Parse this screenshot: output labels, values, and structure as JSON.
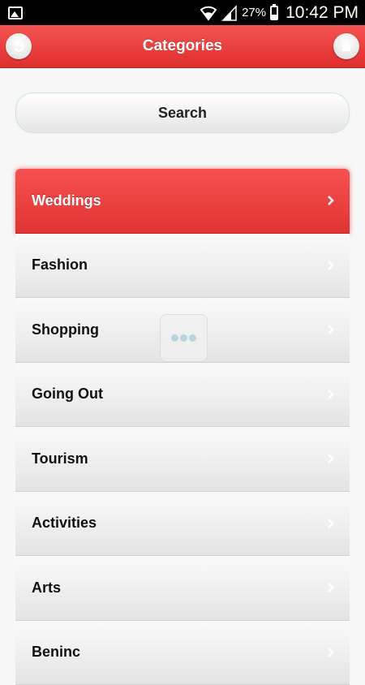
{
  "status_bar": {
    "battery_percent": "27%",
    "time": "10:42 PM"
  },
  "nav": {
    "title": "Categories",
    "back_icon": "back-arrow-icon",
    "home_icon": "home-icon"
  },
  "search": {
    "label": "Search"
  },
  "categories": [
    {
      "label": "Weddings",
      "active": true
    },
    {
      "label": "Fashion",
      "active": false
    },
    {
      "label": "Shopping",
      "active": false
    },
    {
      "label": "Going Out",
      "active": false
    },
    {
      "label": "Tourism",
      "active": false
    },
    {
      "label": "Activities",
      "active": false
    },
    {
      "label": "Arts",
      "active": false
    },
    {
      "label": "Beninc",
      "active": false
    }
  ],
  "colors": {
    "accent": "#e63c3c"
  }
}
